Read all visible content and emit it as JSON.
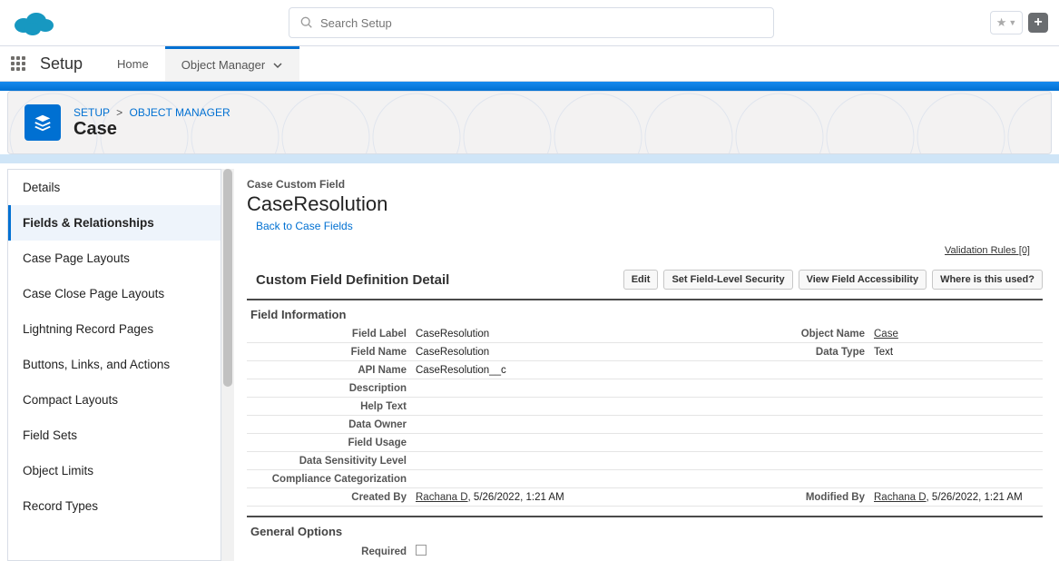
{
  "search": {
    "placeholder": "Search Setup"
  },
  "app_name": "Setup",
  "nav": {
    "home": "Home",
    "object_manager": "Object Manager"
  },
  "breadcrumb": {
    "setup": "SETUP",
    "om": "OBJECT MANAGER"
  },
  "object_title": "Case",
  "sidebar": {
    "items": [
      "Details",
      "Fields & Relationships",
      "Case Page Layouts",
      "Case Close Page Layouts",
      "Lightning Record Pages",
      "Buttons, Links, and Actions",
      "Compact Layouts",
      "Field Sets",
      "Object Limits",
      "Record Types"
    ]
  },
  "main": {
    "eyebrow": "Case Custom Field",
    "title": "CaseResolution",
    "back": "Back to Case Fields",
    "validation_rules": "Validation Rules [0]",
    "section_title": "Custom Field Definition Detail",
    "buttons": {
      "edit": "Edit",
      "fls": "Set Field-Level Security",
      "vfa": "View Field Accessibility",
      "where": "Where is this used?"
    },
    "subhead1": "Field Information",
    "rows": {
      "field_label": {
        "l": "Field Label",
        "v": "CaseResolution"
      },
      "object_name": {
        "l": "Object Name",
        "v": "Case"
      },
      "field_name": {
        "l": "Field Name",
        "v": "CaseResolution"
      },
      "data_type": {
        "l": "Data Type",
        "v": "Text"
      },
      "api_name": {
        "l": "API Name",
        "v": "CaseResolution__c"
      },
      "description": {
        "l": "Description",
        "v": ""
      },
      "help_text": {
        "l": "Help Text",
        "v": ""
      },
      "data_owner": {
        "l": "Data Owner",
        "v": ""
      },
      "field_usage": {
        "l": "Field Usage",
        "v": ""
      },
      "sensitivity": {
        "l": "Data Sensitivity Level",
        "v": ""
      },
      "compliance": {
        "l": "Compliance Categorization",
        "v": ""
      },
      "created_by": {
        "l": "Created By",
        "name": "Rachana D",
        "rest": ", 5/26/2022, 1:21 AM"
      },
      "modified_by": {
        "l": "Modified By",
        "name": "Rachana D",
        "rest": ", 5/26/2022, 1:21 AM"
      }
    },
    "subhead2": "General Options",
    "required_label": "Required"
  }
}
